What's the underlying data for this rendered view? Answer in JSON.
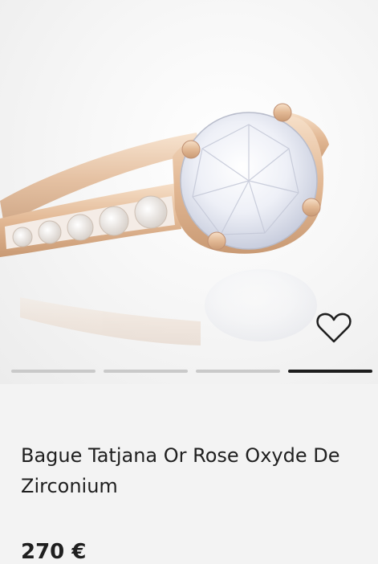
{
  "product": {
    "title": "Bague Tatjana Or Rose Oxyde De Zirconium",
    "price": "270 €"
  },
  "gallery": {
    "image_count": 4,
    "active_index": 3,
    "favorite_icon": "heart-outline-icon"
  },
  "colors": {
    "page_background": "#f3f3f3",
    "active_indicator": "#1d1d1d",
    "inactive_indicator": "#c9c9c9",
    "ring_metal": "#e6c3a4"
  }
}
